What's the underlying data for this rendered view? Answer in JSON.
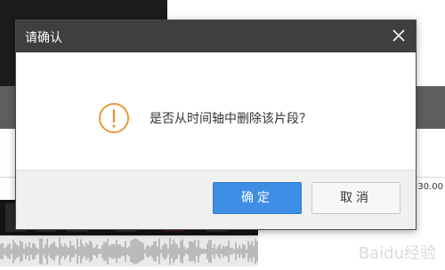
{
  "background": {
    "timeline_value": "30.00",
    "watermark": "Baidu经验"
  },
  "dialog": {
    "title": "请确认",
    "close_icon": "close-icon",
    "warning_icon": "exclamation-circle-icon",
    "message": "是否从时间轴中删除该片段？",
    "confirm_label": "确定",
    "cancel_label": "取消",
    "colors": {
      "header": "#3f3f3f",
      "accent": "#3e8ee6",
      "warning": "#e89a3c"
    }
  }
}
